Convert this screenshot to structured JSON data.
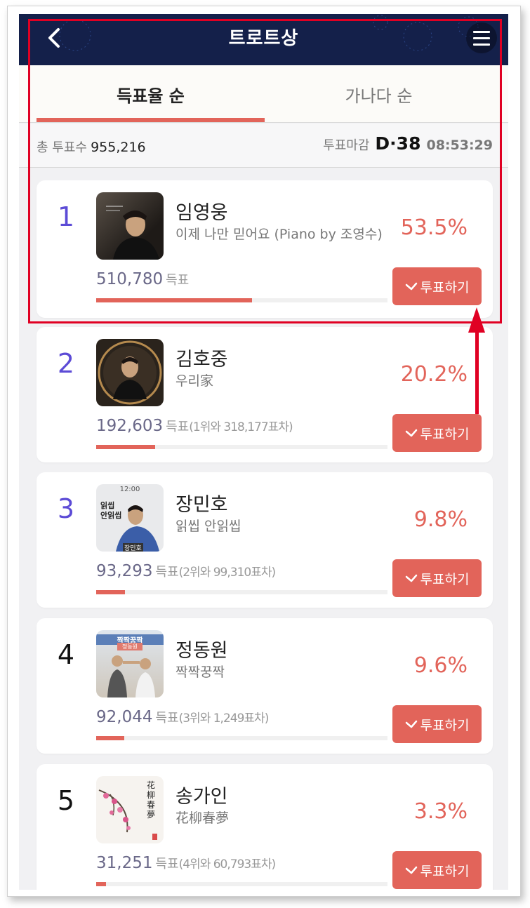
{
  "header": {
    "title": "트로트상"
  },
  "tabs": [
    {
      "label": "득표율 순",
      "active": true
    },
    {
      "label": "가나다 순",
      "active": false
    }
  ],
  "stats": {
    "total_label": "총 투표수",
    "total_value": "955,216",
    "deadline_label": "투표마감",
    "dday": "D·38",
    "timer": "08:53:29"
  },
  "vote_label": "투표하기",
  "accent_color": "#e2645a",
  "rank_color": "#5c4bd6",
  "candidates": [
    {
      "rank": "1",
      "name": "임영웅",
      "song": "이제 나만 믿어요 (Piano by 조영수)",
      "percent": "53.5%",
      "votes": "510,780",
      "unit": "득표",
      "gap": "",
      "share": 0.535
    },
    {
      "rank": "2",
      "name": "김호중",
      "song": "우리家",
      "percent": "20.2%",
      "votes": "192,603",
      "unit": "득표",
      "gap": "(1위와 318,177표차)",
      "share": 0.202
    },
    {
      "rank": "3",
      "name": "장민호",
      "song": "읽씹 안읽씹",
      "percent": "9.8%",
      "votes": "93,293",
      "unit": "득표",
      "gap": "(2위와 99,310표차)",
      "share": 0.098
    },
    {
      "rank": "4",
      "name": "정동원",
      "song": "짝짝꿍짝",
      "percent": "9.6%",
      "votes": "92,044",
      "unit": "득표",
      "gap": "(3위와 1,249표차)",
      "share": 0.096
    },
    {
      "rank": "5",
      "name": "송가인",
      "song": "花柳春夢",
      "percent": "3.3%",
      "votes": "31,251",
      "unit": "득표",
      "gap": "(4위와 60,793표차)",
      "share": 0.033
    }
  ],
  "thumbs": {
    "c3_time": "12:00",
    "c3_text1": "읽씹",
    "c3_text2": "안읽씹",
    "c3_name": "장민호",
    "c4_title": "짝짝꿍짝",
    "c4_name": "정동원",
    "c5_calligraphy": "花柳春夢"
  }
}
